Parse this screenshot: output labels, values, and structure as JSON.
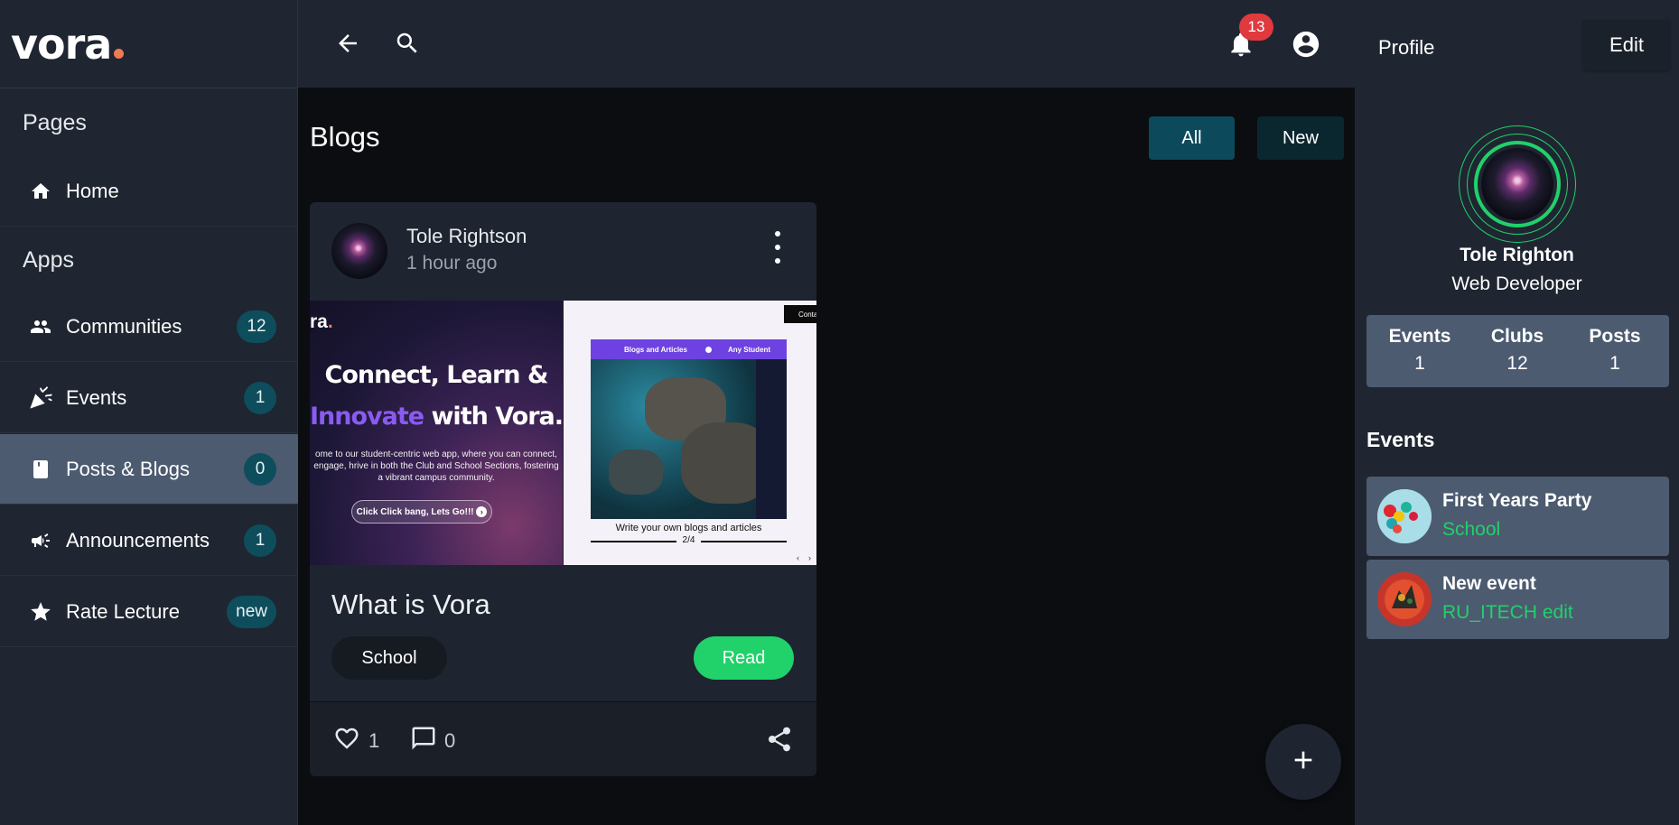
{
  "app": {
    "logo_text": "vora"
  },
  "colors": {
    "accent_green": "#21d16a",
    "badge_teal": "#0e4d5c",
    "active_nav": "#4c5b70",
    "notification_red": "#e0393e",
    "logo_dot": "#f07a55"
  },
  "sidebar": {
    "pages_label": "Pages",
    "apps_label": "Apps",
    "pages": [
      {
        "label": "Home",
        "icon": "home-icon"
      }
    ],
    "apps": [
      {
        "label": "Communities",
        "icon": "people-icon",
        "badge": "12"
      },
      {
        "label": "Events",
        "icon": "party-popper-icon",
        "badge": "1"
      },
      {
        "label": "Posts & Blogs",
        "icon": "book-icon",
        "badge": "0",
        "active": true
      },
      {
        "label": "Announcements",
        "icon": "megaphone-icon",
        "badge": "1"
      },
      {
        "label": "Rate Lecture",
        "icon": "star-icon",
        "badge": "new"
      }
    ]
  },
  "topbar": {
    "notification_count": "13",
    "profile_label": "Profile",
    "edit_label": "Edit"
  },
  "main": {
    "title": "Blogs",
    "filters": [
      {
        "label": "All",
        "active": true
      },
      {
        "label": "New",
        "active": false
      }
    ]
  },
  "post": {
    "author": "Tole Rightson",
    "time": "1 hour ago",
    "image": {
      "brand": "ra",
      "headline_line1": "Connect, Learn &",
      "headline_line2_highlight": "Innovate",
      "headline_line2_rest": " with Vora.",
      "description": "ome to our student-centric web app, where you can connect, engage, hrive in both the Club and School Sections, fostering a vibrant campus community.",
      "cta": "Click Click bang, Lets Go!!!",
      "contact": "Conta",
      "bar_left": "Blogs and Articles",
      "bar_right": "Any Student",
      "caption": "Write your own blogs and articles",
      "counter": "2/4"
    },
    "title": "What is Vora",
    "tag": "School",
    "read_label": "Read",
    "likes": "1",
    "comments": "0"
  },
  "profile": {
    "name": "Tole Righton",
    "role": "Web Developer",
    "stats": [
      {
        "label": "Events",
        "value": "1"
      },
      {
        "label": "Clubs",
        "value": "12"
      },
      {
        "label": "Posts",
        "value": "1"
      }
    ],
    "events_heading": "Events",
    "events": [
      {
        "title": "First Years Party",
        "subtitle": "School"
      },
      {
        "title": "New event",
        "subtitle": "RU_ITECH edit"
      }
    ]
  }
}
